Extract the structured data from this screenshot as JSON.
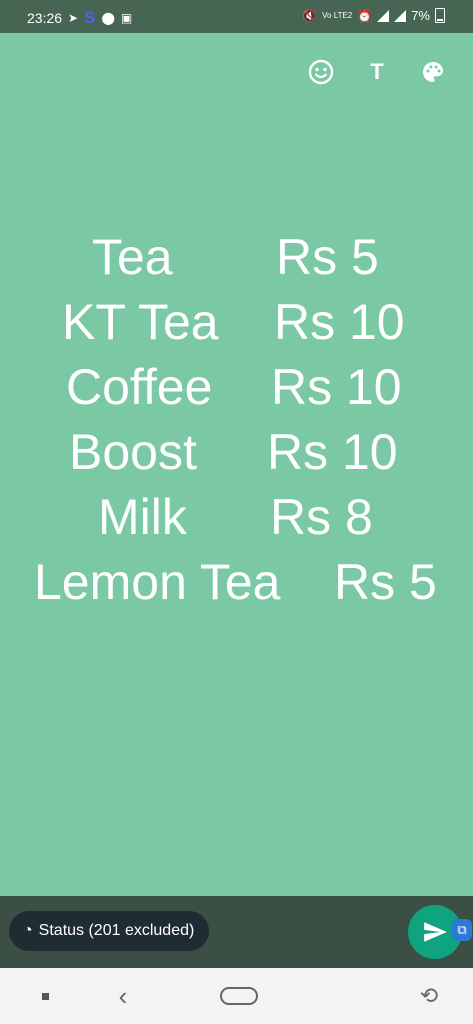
{
  "status_bar": {
    "time": "23:26",
    "s_badge": "S",
    "battery_percent": "7%",
    "volte_label": "Vo LTE2",
    "icons": [
      "telegram-icon",
      "location-icon",
      "battery-saver-icon",
      "mute-icon",
      "alarm-icon",
      "signal-icon",
      "signal-icon",
      "battery-icon"
    ]
  },
  "editor_toolbar": {
    "emoji_icon": "😊",
    "text_icon": "T",
    "palette_icon": "🎨"
  },
  "menu_items": [
    {
      "name": "Tea",
      "price": "Rs 5"
    },
    {
      "name": "KT Tea",
      "price": "Rs 10"
    },
    {
      "name": "Coffee",
      "price": "Rs 10"
    },
    {
      "name": "Boost",
      "price": "Rs 10"
    },
    {
      "name": "Milk",
      "price": "Rs 8"
    },
    {
      "name": "Lemon Tea",
      "price": "Rs 5"
    }
  ],
  "bottom": {
    "status_chip_label": "Status (201 excluded)",
    "send_icon": "send-icon"
  },
  "colors": {
    "background": "#7bc8a4",
    "send_button": "#10a37f",
    "chip": "#1f2c33"
  }
}
